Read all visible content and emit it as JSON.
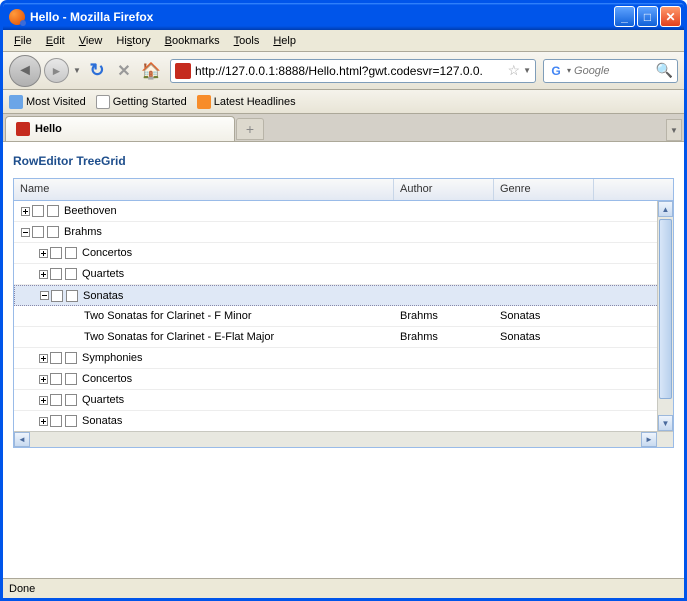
{
  "window": {
    "title": "Hello - Mozilla Firefox"
  },
  "menu": {
    "file": "File",
    "edit": "Edit",
    "view": "View",
    "history": "History",
    "bookmarks": "Bookmarks",
    "tools": "Tools",
    "help": "Help"
  },
  "url": "http://127.0.0.1:8888/Hello.html?gwt.codesvr=127.0.0.",
  "search_placeholder": "Google",
  "bookmarks": {
    "most_visited": "Most Visited",
    "getting_started": "Getting Started",
    "latest_headlines": "Latest Headlines"
  },
  "tab": {
    "title": "Hello"
  },
  "heading": "RowEditor TreeGrid",
  "columns": {
    "name": "Name",
    "author": "Author",
    "genre": "Genre"
  },
  "rows": [
    {
      "level": 0,
      "expander": "+",
      "checks": 2,
      "name": "Beethoven",
      "author": "",
      "genre": ""
    },
    {
      "level": 0,
      "expander": "-",
      "checks": 2,
      "name": "Brahms",
      "author": "",
      "genre": ""
    },
    {
      "level": 1,
      "expander": "+",
      "checks": 2,
      "name": "Concertos",
      "author": "",
      "genre": ""
    },
    {
      "level": 1,
      "expander": "+",
      "checks": 2,
      "name": "Quartets",
      "author": "",
      "genre": ""
    },
    {
      "level": 1,
      "expander": "-",
      "checks": 2,
      "name": "Sonatas",
      "author": "",
      "genre": "",
      "selected": true
    },
    {
      "level": 2,
      "expander": "",
      "checks": 0,
      "name": "Two Sonatas for Clarinet - F Minor",
      "author": "Brahms",
      "genre": "Sonatas"
    },
    {
      "level": 2,
      "expander": "",
      "checks": 0,
      "name": "Two Sonatas for Clarinet - E-Flat Major",
      "author": "Brahms",
      "genre": "Sonatas"
    },
    {
      "level": 1,
      "expander": "+",
      "checks": 2,
      "name": "Symphonies",
      "author": "",
      "genre": ""
    },
    {
      "level": 1,
      "expander": "+",
      "checks": 2,
      "name": "Concertos",
      "author": "",
      "genre": ""
    },
    {
      "level": 1,
      "expander": "+",
      "checks": 2,
      "name": "Quartets",
      "author": "",
      "genre": ""
    },
    {
      "level": 1,
      "expander": "+",
      "checks": 2,
      "name": "Sonatas",
      "author": "",
      "genre": ""
    }
  ],
  "status": "Done"
}
